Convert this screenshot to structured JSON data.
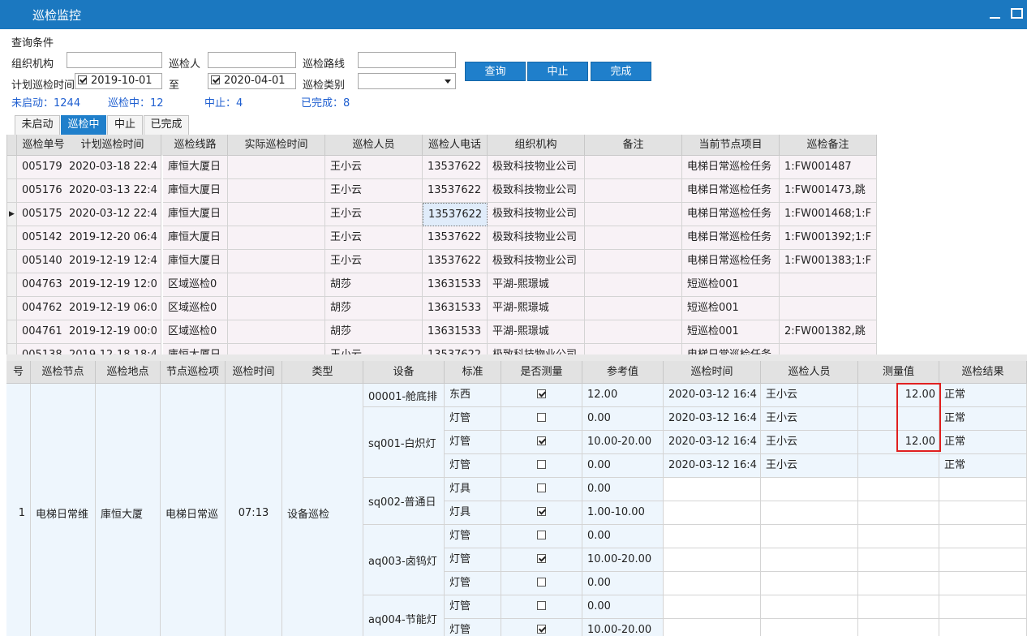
{
  "window": {
    "title": "巡检监控"
  },
  "query": {
    "section_title": "查询条件",
    "org_label": "组织机构",
    "org_value": "",
    "inspector_label": "巡检人",
    "inspector_value": "",
    "route_label": "巡检路线",
    "route_value": "",
    "plan_time_label": "计划巡检时间",
    "date_from": "2019-10-01",
    "date_from_checked": true,
    "to_label": "至",
    "date_to": "2020-04-01",
    "date_to_checked": true,
    "category_label": "巡检类别",
    "category_value": "",
    "buttons": {
      "query": "查询",
      "abort": "中止",
      "complete": "完成"
    }
  },
  "stats": {
    "not_started": "未启动：1244",
    "in_progress": "巡检中：12",
    "aborted": "中止：4",
    "completed": "已完成：8"
  },
  "tabs": [
    {
      "label": "未启动",
      "active": false
    },
    {
      "label": "巡检中",
      "active": true
    },
    {
      "label": "中止",
      "active": false
    },
    {
      "label": "已完成",
      "active": false
    }
  ],
  "task_grid": {
    "columns": [
      "巡检单号",
      "计划巡检时间",
      "巡检线路",
      "实际巡检时间",
      "巡检人员",
      "巡检人电话",
      "组织机构",
      "备注",
      "当前节点项目",
      "巡检备注"
    ],
    "selected_row": 2,
    "rows": [
      [
        "005179",
        "2020-03-18 22:4",
        "庫恒大厦日",
        "",
        "王小云",
        "13537622",
        "极致科技物业公司",
        "",
        "电梯日常巡检任务",
        "1:FW001487"
      ],
      [
        "005176",
        "2020-03-13 22:4",
        "庫恒大厦日",
        "",
        "王小云",
        "13537622",
        "极致科技物业公司",
        "",
        "电梯日常巡检任务",
        "1:FW001473,跳"
      ],
      [
        "005175",
        "2020-03-12 22:4",
        "庫恒大厦日",
        "",
        "王小云",
        "13537622",
        "极致科技物业公司",
        "",
        "电梯日常巡检任务",
        "1:FW001468;1:F"
      ],
      [
        "005142",
        "2019-12-20 06:4",
        "庫恒大厦日",
        "",
        "王小云",
        "13537622",
        "极致科技物业公司",
        "",
        "电梯日常巡检任务",
        "1:FW001392;1:F"
      ],
      [
        "005140",
        "2019-12-19 12:4",
        "庫恒大厦日",
        "",
        "王小云",
        "13537622",
        "极致科技物业公司",
        "",
        "电梯日常巡检任务",
        "1:FW001383;1:F"
      ],
      [
        "004763",
        "2019-12-19 12:0",
        "区域巡检0",
        "",
        "胡莎",
        "13631533",
        "平湖-熙璟城",
        "",
        "短巡检001",
        ""
      ],
      [
        "004762",
        "2019-12-19 06:0",
        "区域巡检0",
        "",
        "胡莎",
        "13631533",
        "平湖-熙璟城",
        "",
        "短巡检001",
        ""
      ],
      [
        "004761",
        "2019-12-19 00:0",
        "区域巡检0",
        "",
        "胡莎",
        "13631533",
        "平湖-熙璟城",
        "",
        "短巡检001",
        "2:FW001382,跳"
      ],
      [
        "005138",
        "2019-12-18 18:4",
        "庫恒大厦日",
        "",
        "王小云",
        "13537622",
        "极致科技物业公司",
        "",
        "电梯日常巡检任务",
        ""
      ]
    ]
  },
  "detail_grid": {
    "columns": [
      "号",
      "巡检节点",
      "巡检地点",
      "节点巡检项",
      "巡检时间",
      "类型",
      "设备",
      "标准",
      "是否测量",
      "参考值",
      "巡检时间",
      "巡检人员",
      "测量值",
      "巡检结果"
    ],
    "node": {
      "index": "1",
      "node": "电梯日常维",
      "location": "庫恒大厦",
      "item": "电梯日常巡",
      "time": "07:13",
      "type": "设备巡检"
    },
    "devices": [
      {
        "name": "00001-舱底排",
        "rows": 1
      },
      {
        "name": "sq001-白炽灯",
        "rows": 3
      },
      {
        "name": "sq002-普通日",
        "rows": 2
      },
      {
        "name": "aq003-卤钨灯",
        "rows": 3
      },
      {
        "name": "aq004-节能灯",
        "rows": 2
      }
    ],
    "rows": [
      {
        "standard": "东西",
        "measure": true,
        "ref": "12.00",
        "time": "2020-03-12 16:4",
        "person": "王小云",
        "value": "12.00",
        "result": "正常"
      },
      {
        "standard": "灯管",
        "measure": false,
        "ref": "0.00",
        "time": "2020-03-12 16:4",
        "person": "王小云",
        "value": "",
        "result": "正常"
      },
      {
        "standard": "灯管",
        "measure": true,
        "ref": "10.00-20.00",
        "time": "2020-03-12 16:4",
        "person": "王小云",
        "value": "12.00",
        "result": "正常"
      },
      {
        "standard": "灯管",
        "measure": false,
        "ref": "0.00",
        "time": "2020-03-12 16:4",
        "person": "王小云",
        "value": "",
        "result": "正常"
      },
      {
        "standard": "灯具",
        "measure": false,
        "ref": "0.00",
        "time": "",
        "person": "",
        "value": "",
        "result": ""
      },
      {
        "standard": "灯具",
        "measure": true,
        "ref": "1.00-10.00",
        "time": "",
        "person": "",
        "value": "",
        "result": ""
      },
      {
        "standard": "灯管",
        "measure": false,
        "ref": "0.00",
        "time": "",
        "person": "",
        "value": "",
        "result": ""
      },
      {
        "standard": "灯管",
        "measure": true,
        "ref": "10.00-20.00",
        "time": "",
        "person": "",
        "value": "",
        "result": ""
      },
      {
        "standard": "灯管",
        "measure": false,
        "ref": "0.00",
        "time": "",
        "person": "",
        "value": "",
        "result": ""
      },
      {
        "standard": "灯管",
        "measure": false,
        "ref": "0.00",
        "time": "",
        "person": "",
        "value": "",
        "result": ""
      },
      {
        "standard": "灯管",
        "measure": true,
        "ref": "10.00-20.00",
        "time": "",
        "person": "",
        "value": "",
        "result": ""
      }
    ]
  },
  "colors": {
    "titlebar": "#1b78c0",
    "accent": "#1f7fcb",
    "stat_text": "#1f5fd0",
    "highlight_box": "#e02020"
  }
}
